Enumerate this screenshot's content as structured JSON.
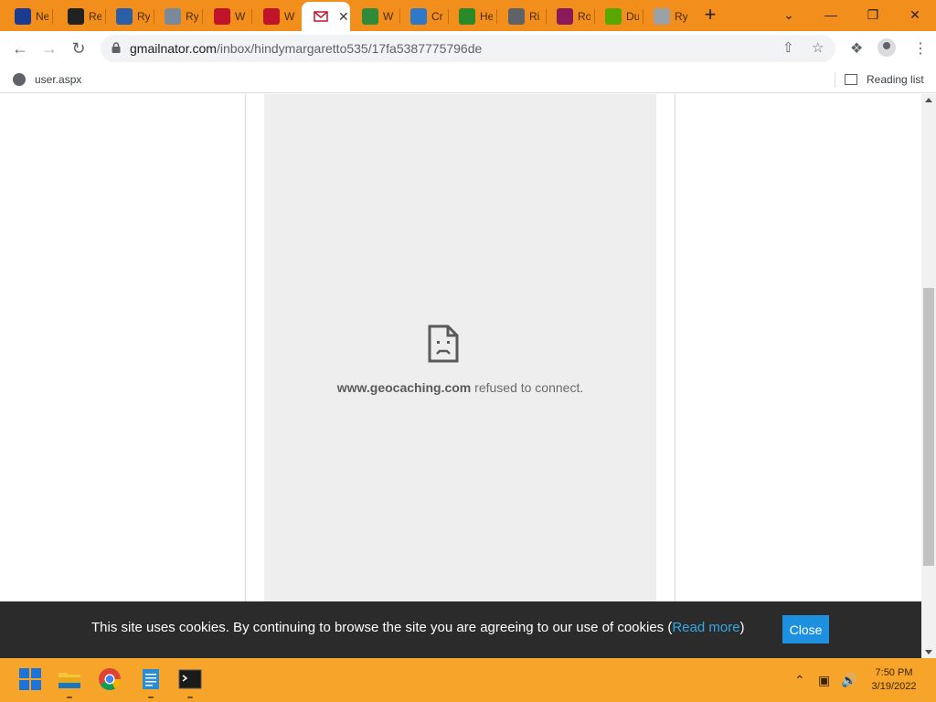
{
  "browser": {
    "tabs": [
      {
        "title": "Ne",
        "icon": "v-logo-icon",
        "color": "#1a3b8f"
      },
      {
        "title": "Re",
        "icon": "paw-icon",
        "color": "#222222"
      },
      {
        "title": "Ry",
        "icon": "building-icon",
        "color": "#2a5fa8"
      },
      {
        "title": "Ry",
        "icon": "wrench-icon",
        "color": "#7a8a9a"
      },
      {
        "title": "W",
        "icon": "w-red-icon",
        "color": "#c0142b"
      },
      {
        "title": "W",
        "icon": "w-red-icon",
        "color": "#c0142b"
      },
      {
        "title": "W",
        "icon": "grid-icon",
        "color": "#2f8a3a"
      },
      {
        "title": "Cr",
        "icon": "puzzle-icon",
        "color": "#2f78c8"
      },
      {
        "title": "He",
        "icon": "leaf-icon",
        "color": "#2a8a2a"
      },
      {
        "title": "Ri",
        "icon": "globe-icon",
        "color": "#5f6368"
      },
      {
        "title": "Ro",
        "icon": "mask-icon",
        "color": "#8a1a5a"
      },
      {
        "title": "Du",
        "icon": "owl-icon",
        "color": "#58a700"
      },
      {
        "title": "Ry",
        "icon": "w-white-icon",
        "color": "#9aa0a6"
      }
    ],
    "active_tab_close": "✕",
    "new_tab": "+",
    "window_controls": {
      "dropdown": "⌄",
      "minimize": "—",
      "restore": "❐",
      "close": "✕"
    },
    "address": {
      "domain": "gmailnator.com",
      "path": "/inbox/hindymargaretto535/17fa5387775796de"
    },
    "bookmarks": [
      {
        "label": "user.aspx"
      }
    ],
    "reading_list": "Reading list"
  },
  "page": {
    "error": {
      "host": "www.geocaching.com",
      "message": " refused to connect."
    },
    "cookie_banner": {
      "text_before": "This site uses cookies. By continuing to browse the site you are agreeing to our use of cookies (",
      "link": "Read more",
      "text_after": ")",
      "close": "Close"
    }
  },
  "taskbar": {
    "clock": {
      "time": "7:50 PM",
      "date": "3/19/2022"
    }
  }
}
